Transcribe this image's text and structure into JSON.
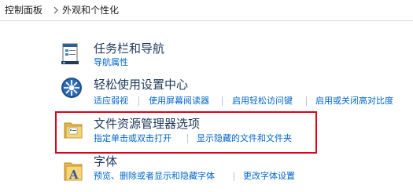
{
  "breadcrumb": {
    "items": [
      "控制面板",
      "外观和个性化"
    ]
  },
  "colors": {
    "title": "#1e395b",
    "link": "#0066cc",
    "highlight_border": "#e0001b"
  },
  "categories": [
    {
      "title": "任务栏和导航",
      "icon": "taskbar-icon",
      "links": [
        "导航属性"
      ]
    },
    {
      "title": "轻松使用设置中心",
      "icon": "ease-of-access-icon",
      "links": [
        "适应弱视",
        "使用屏幕阅读器",
        "启用轻松访问键",
        "启用或关闭高对比度"
      ]
    },
    {
      "title": "文件资源管理器选项",
      "icon": "folder-options-icon",
      "links": [
        "指定单击或双击打开",
        "显示隐藏的文件和文件夹"
      ]
    },
    {
      "title": "字体",
      "icon": "fonts-folder-icon",
      "links": [
        "预览、删除或者显示和隐藏字体",
        "更改字体设置"
      ]
    }
  ]
}
